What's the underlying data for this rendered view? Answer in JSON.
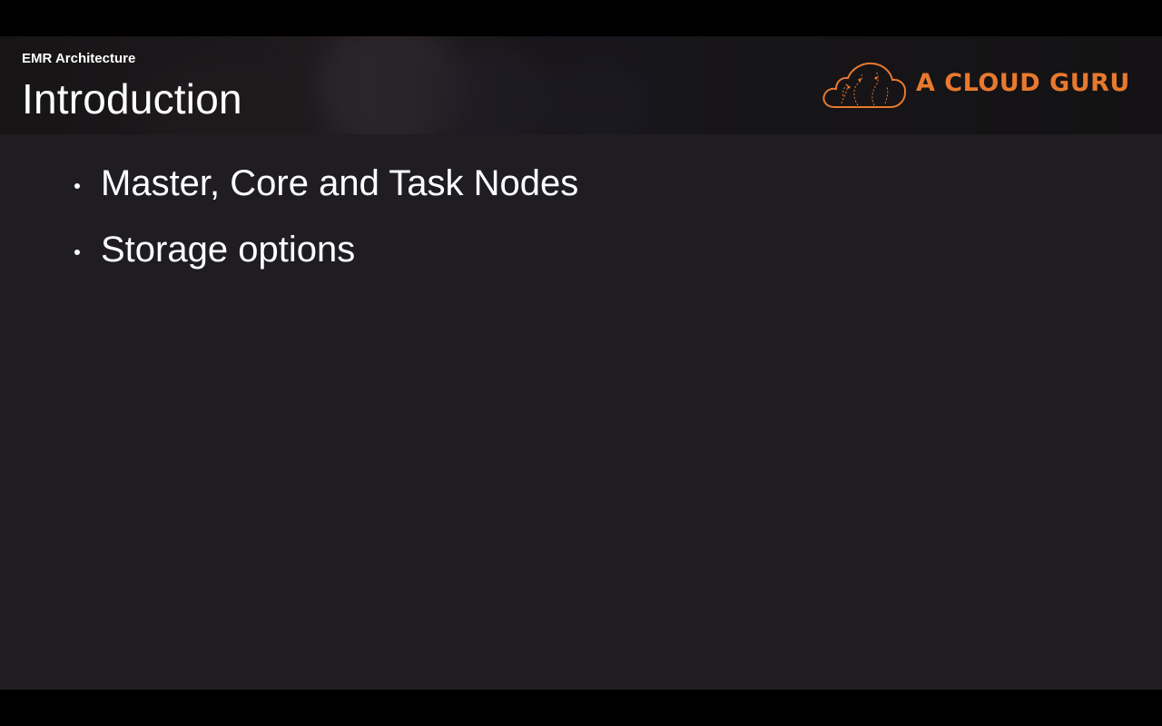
{
  "slide": {
    "section_label": "EMR Architecture",
    "title": "Introduction",
    "bullets": [
      "Master, Core and Task Nodes",
      "Storage options"
    ]
  },
  "brand": {
    "logo_text": "A CLOUD GURU",
    "logo_icon": "cloud-icon",
    "accent_color": "#e8792e"
  },
  "colors": {
    "slide_background": "#1f1d21",
    "letterbox": "#000000",
    "text": "#ffffff"
  }
}
